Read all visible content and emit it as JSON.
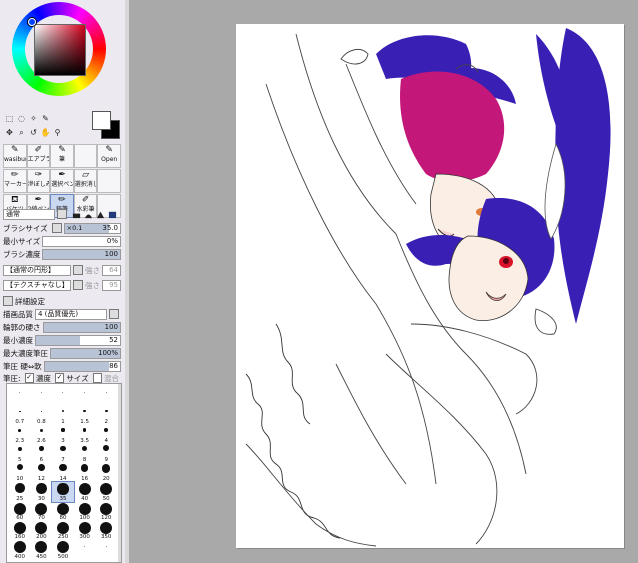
{
  "tools": {
    "row1": [
      "marquee-icon",
      "lasso-icon",
      "magic-wand-icon",
      "picker-icon"
    ],
    "row2": [
      "move-icon",
      "zoom-icon",
      "rotate-icon",
      "hand-icon",
      "eyedropper-icon"
    ]
  },
  "brushes": [
    {
      "label": "wasiburu",
      "icon": "brush"
    },
    {
      "label": "エアブラ",
      "icon": "airbrush"
    },
    {
      "label": "筆",
      "icon": "brush"
    },
    {
      "label": "",
      "icon": ""
    },
    {
      "label": "Open",
      "icon": "brush"
    },
    {
      "label": "マーカー",
      "icon": "marker"
    },
    {
      "label": "滲ぼしみ",
      "icon": "blur"
    },
    {
      "label": "選択ペン",
      "icon": "pen"
    },
    {
      "label": "選択消し",
      "icon": "eraser"
    },
    {
      "label": "",
      "icon": ""
    },
    {
      "label": "バケツ",
      "icon": "bucket"
    },
    {
      "label": "2値ペン",
      "icon": "pen"
    },
    {
      "label": "鉛筆",
      "icon": "pencil",
      "selected": true
    },
    {
      "label": "水彩筆",
      "icon": "watercolor"
    },
    {
      "label": "",
      "icon": ""
    }
  ],
  "settings": {
    "blend_mode": "通常",
    "brush_size_label": "ブラシサイズ",
    "brush_size_mult": "×0.1",
    "brush_size_value": "35.0",
    "brush_size_fill": 0.8,
    "min_size_label": "最小サイズ",
    "min_size_value": "0%",
    "min_size_fill": 0.0,
    "density_label": "ブラシ濃度",
    "density_value": "100",
    "density_fill": 1.0,
    "shape_option": "【通常の円形】",
    "shape_strength": "強さ",
    "shape_value": "64",
    "texture_option": "【テクスチャなし】",
    "texture_strength": "強さ",
    "texture_value": "95",
    "advanced_label": "詳細設定",
    "quality_label": "描画品質",
    "quality_value": "4 (品質優先)",
    "edge_label": "輪郭の硬さ",
    "edge_value": "100",
    "edge_fill": 1.0,
    "min_density_label": "最小濃度",
    "min_density_value": "52",
    "min_density_fill": 0.52,
    "max_pressure_label": "最大濃度筆圧",
    "max_pressure_value": "100%",
    "max_pressure_fill": 1.0,
    "pressure_label": "筆圧 硬⇔軟",
    "pressure_value": "86",
    "pressure_fill": 0.86,
    "pressure2_label": "筆圧:",
    "density_check": "濃度",
    "size_check": "サイズ",
    "blend_check": "混合"
  },
  "brush_sizes": [
    "",
    "",
    "",
    "",
    "",
    "0.7",
    "0.8",
    "1",
    "1.5",
    "2",
    "2.3",
    "2.6",
    "3",
    "3.5",
    "4",
    "5",
    "6",
    "7",
    "8",
    "9",
    "10",
    "12",
    "14",
    "16",
    "20",
    "25",
    "30",
    "35",
    "40",
    "50",
    "60",
    "70",
    "80",
    "100",
    "120",
    "160",
    "200",
    "250",
    "300",
    "350",
    "400",
    "450",
    "500",
    "",
    ""
  ],
  "selected_size": "35",
  "colors": {
    "hair_magenta": "#c4177a",
    "hair_blue": "#3a1fb5",
    "eye_red": "#d9142a",
    "skin": "#fbeee4"
  }
}
